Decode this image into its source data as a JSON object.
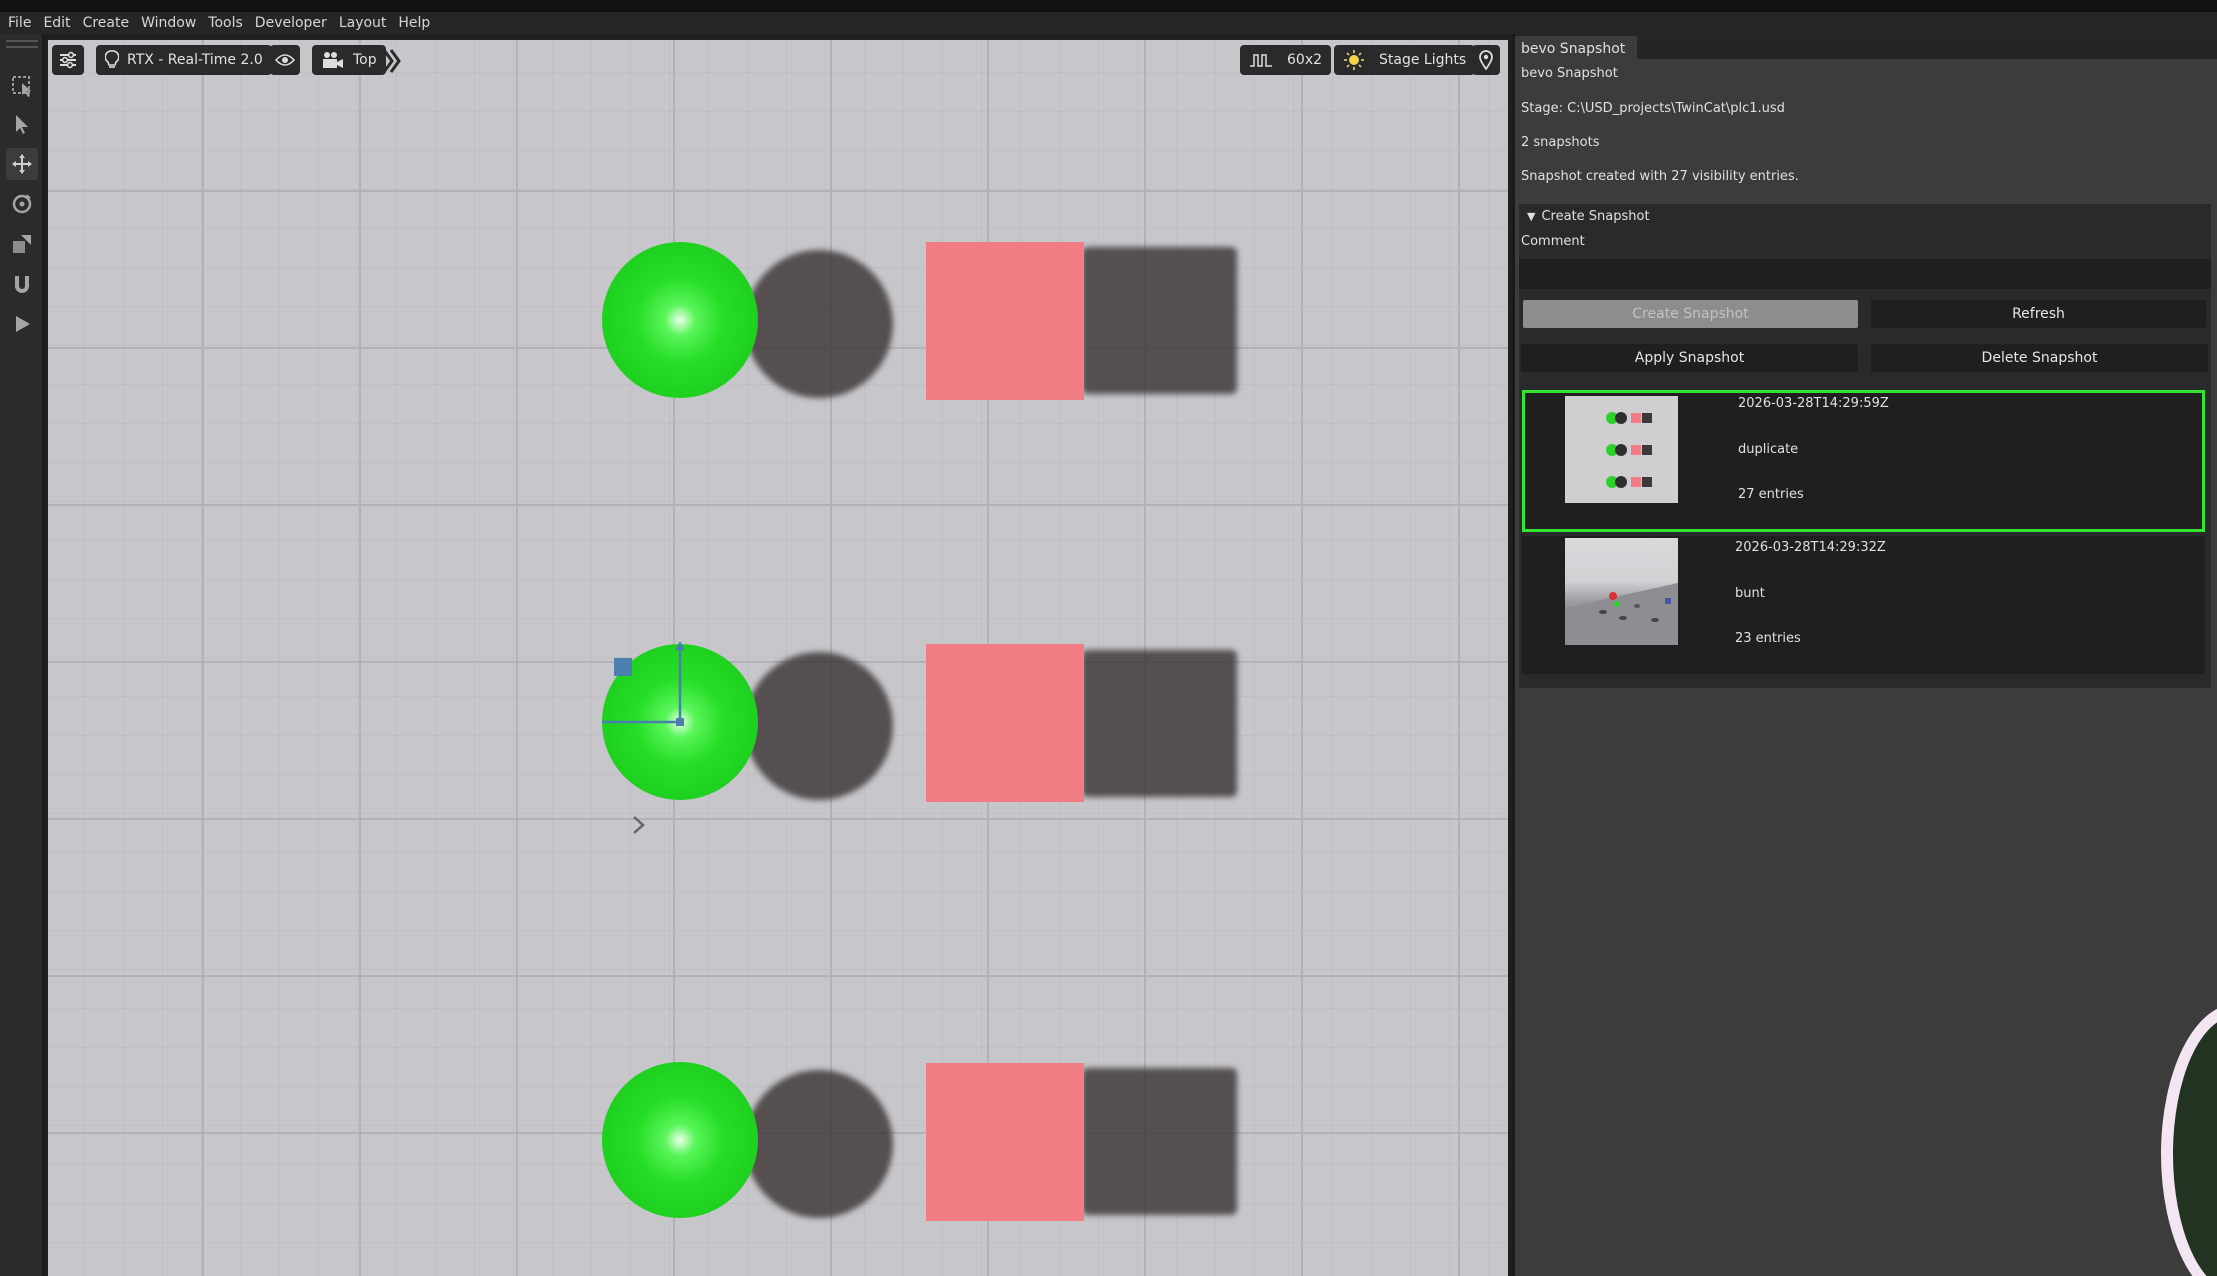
{
  "menu": [
    "File",
    "Edit",
    "Create",
    "Window",
    "Tools",
    "Developer",
    "Layout",
    "Help"
  ],
  "viewport": {
    "renderer": "RTX - Real-Time 2.0",
    "camera": "Top",
    "fps": "60x2",
    "lights": "Stage Lights"
  },
  "panel": {
    "tab_label": "bevo Snapshot",
    "heading": "bevo Snapshot",
    "stage_path": "Stage: C:\\USD_projects\\TwinCat\\plc1.usd",
    "snapshot_count": "2 snapshots",
    "status": "Snapshot created with 27 visibility entries.",
    "section_title": "Create Snapshot",
    "comment_label": "Comment",
    "comment_value": "",
    "create_label": "Create Snapshot",
    "refresh_label": "Refresh",
    "apply_label": "Apply Snapshot",
    "delete_label": "Delete Snapshot",
    "snapshots": [
      {
        "timestamp": "2026-03-28T14:29:59Z",
        "comment": "duplicate",
        "entries": "27 entries",
        "selected": true
      },
      {
        "timestamp": "2026-03-28T14:29:32Z",
        "comment": "bunt",
        "entries": "23 entries",
        "selected": false
      }
    ]
  },
  "colors": {
    "selection": "#33e533",
    "sphere": "#26dd26",
    "cube": "#f27c84",
    "gizmo": "#4a7fb0"
  }
}
